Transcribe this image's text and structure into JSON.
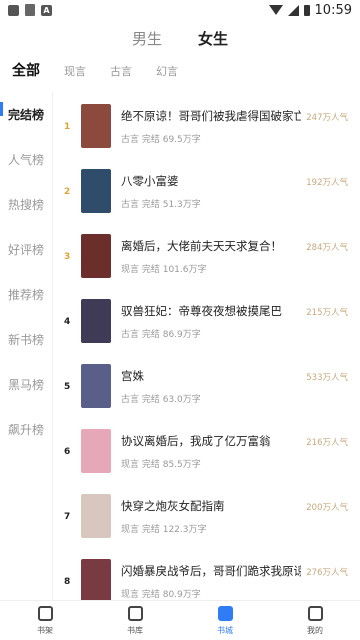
{
  "status": {
    "time": "10:59"
  },
  "gender_tabs": [
    {
      "label": "男生"
    },
    {
      "label": "女生"
    }
  ],
  "category_tabs": [
    {
      "label": "全部"
    },
    {
      "label": "现言"
    },
    {
      "label": "古言"
    },
    {
      "label": "幻言"
    }
  ],
  "sidebar": [
    {
      "label": "完结榜"
    },
    {
      "label": "人气榜"
    },
    {
      "label": "热搜榜"
    },
    {
      "label": "好评榜"
    },
    {
      "label": "推荐榜"
    },
    {
      "label": "新书榜"
    },
    {
      "label": "黑马榜"
    },
    {
      "label": "飙升榜"
    }
  ],
  "books": [
    {
      "rank": "1",
      "title": "绝不原谅！哥哥们被我虐得国破家亡",
      "meta": "古言 完结 69.5万字",
      "popularity": "247万人气",
      "cover_color": "#8b4a3d"
    },
    {
      "rank": "2",
      "title": "八零小富婆",
      "meta": "古言 完结 51.3万字",
      "popularity": "192万人气",
      "cover_color": "#2f4c6b"
    },
    {
      "rank": "3",
      "title": "离婚后，大佬前夫天天求复合！",
      "meta": "现言 完结 101.6万字",
      "popularity": "284万人气",
      "cover_color": "#6b2e2a"
    },
    {
      "rank": "4",
      "title": "驭兽狂妃：帝尊夜夜想被摸尾巴",
      "meta": "古言 完结 86.9万字",
      "popularity": "215万人气",
      "cover_color": "#3f3a55"
    },
    {
      "rank": "5",
      "title": "宫姝",
      "meta": "古言 完结 63.0万字",
      "popularity": "533万人气",
      "cover_color": "#5a5f8a"
    },
    {
      "rank": "6",
      "title": "协议离婚后，我成了亿万富翁",
      "meta": "现言 完结 85.5万字",
      "popularity": "216万人气",
      "cover_color": "#e6a7b9"
    },
    {
      "rank": "7",
      "title": "快穿之炮灰女配指南",
      "meta": "现言 完结 122.3万字",
      "popularity": "200万人气",
      "cover_color": "#d9c7bf"
    },
    {
      "rank": "8",
      "title": "闪婚暴戾战爷后，哥哥们跪求我原谅",
      "meta": "现言 完结 80.9万字",
      "popularity": "276万人气",
      "cover_color": "#7a3a42"
    }
  ],
  "bottom_nav": [
    {
      "label": "书架"
    },
    {
      "label": "书库"
    },
    {
      "label": "书城"
    },
    {
      "label": "我的"
    }
  ]
}
